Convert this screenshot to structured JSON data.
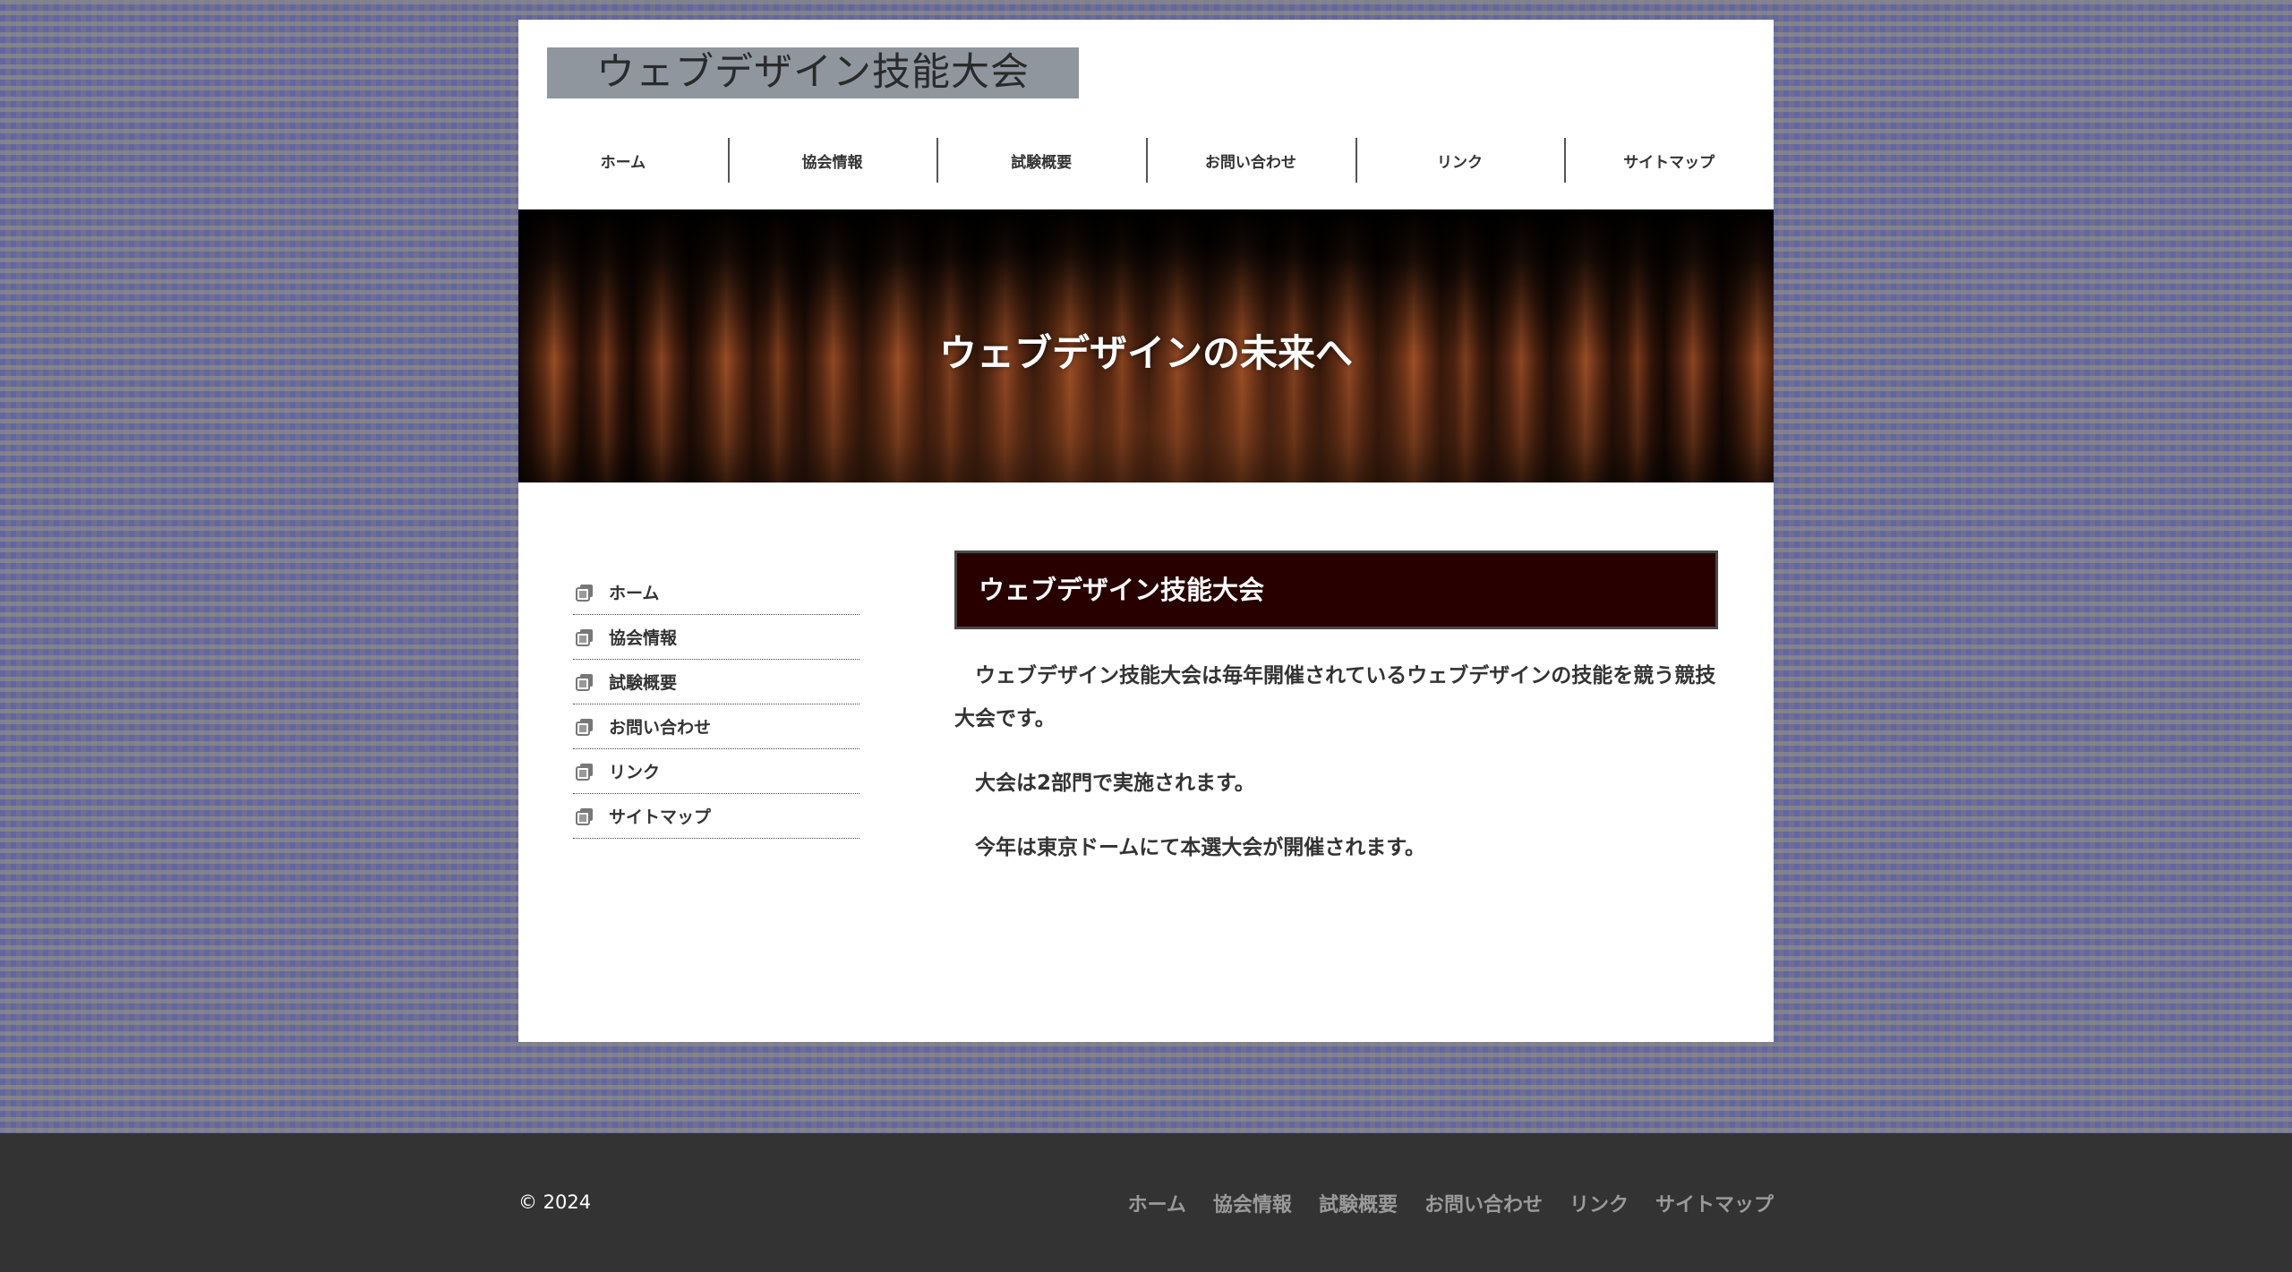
{
  "header": {
    "logo_text": "ウェブデザイン技能大会"
  },
  "top_nav": {
    "items": [
      {
        "label": "ホーム"
      },
      {
        "label": "協会情報"
      },
      {
        "label": "試験概要"
      },
      {
        "label": "お問い合わせ"
      },
      {
        "label": "リンク"
      },
      {
        "label": "サイトマップ"
      }
    ]
  },
  "hero": {
    "title": "ウェブデザインの未来へ"
  },
  "side_nav": {
    "icon": "page-icon",
    "items": [
      {
        "label": "ホーム"
      },
      {
        "label": "協会情報"
      },
      {
        "label": "試験概要"
      },
      {
        "label": "お問い合わせ"
      },
      {
        "label": "リンク"
      },
      {
        "label": "サイトマップ"
      }
    ]
  },
  "main": {
    "section_title": "ウェブデザイン技能大会",
    "paragraphs": [
      "ウェブデザイン技能大会は毎年開催されているウェブデザインの技能を競う競技大会です。",
      "大会は2部門で実施されます。",
      "今年は東京ドームにて本選大会が開催されます。"
    ]
  },
  "footer": {
    "copyright": "© 2024",
    "links": [
      {
        "label": "ホーム"
      },
      {
        "label": "協会情報"
      },
      {
        "label": "試験概要"
      },
      {
        "label": "お問い合わせ"
      },
      {
        "label": "リンク"
      },
      {
        "label": "サイトマップ"
      }
    ]
  },
  "colors": {
    "heading_bg": "#280000",
    "footer_bg": "#333333",
    "logo_bg": "#8f969e"
  }
}
